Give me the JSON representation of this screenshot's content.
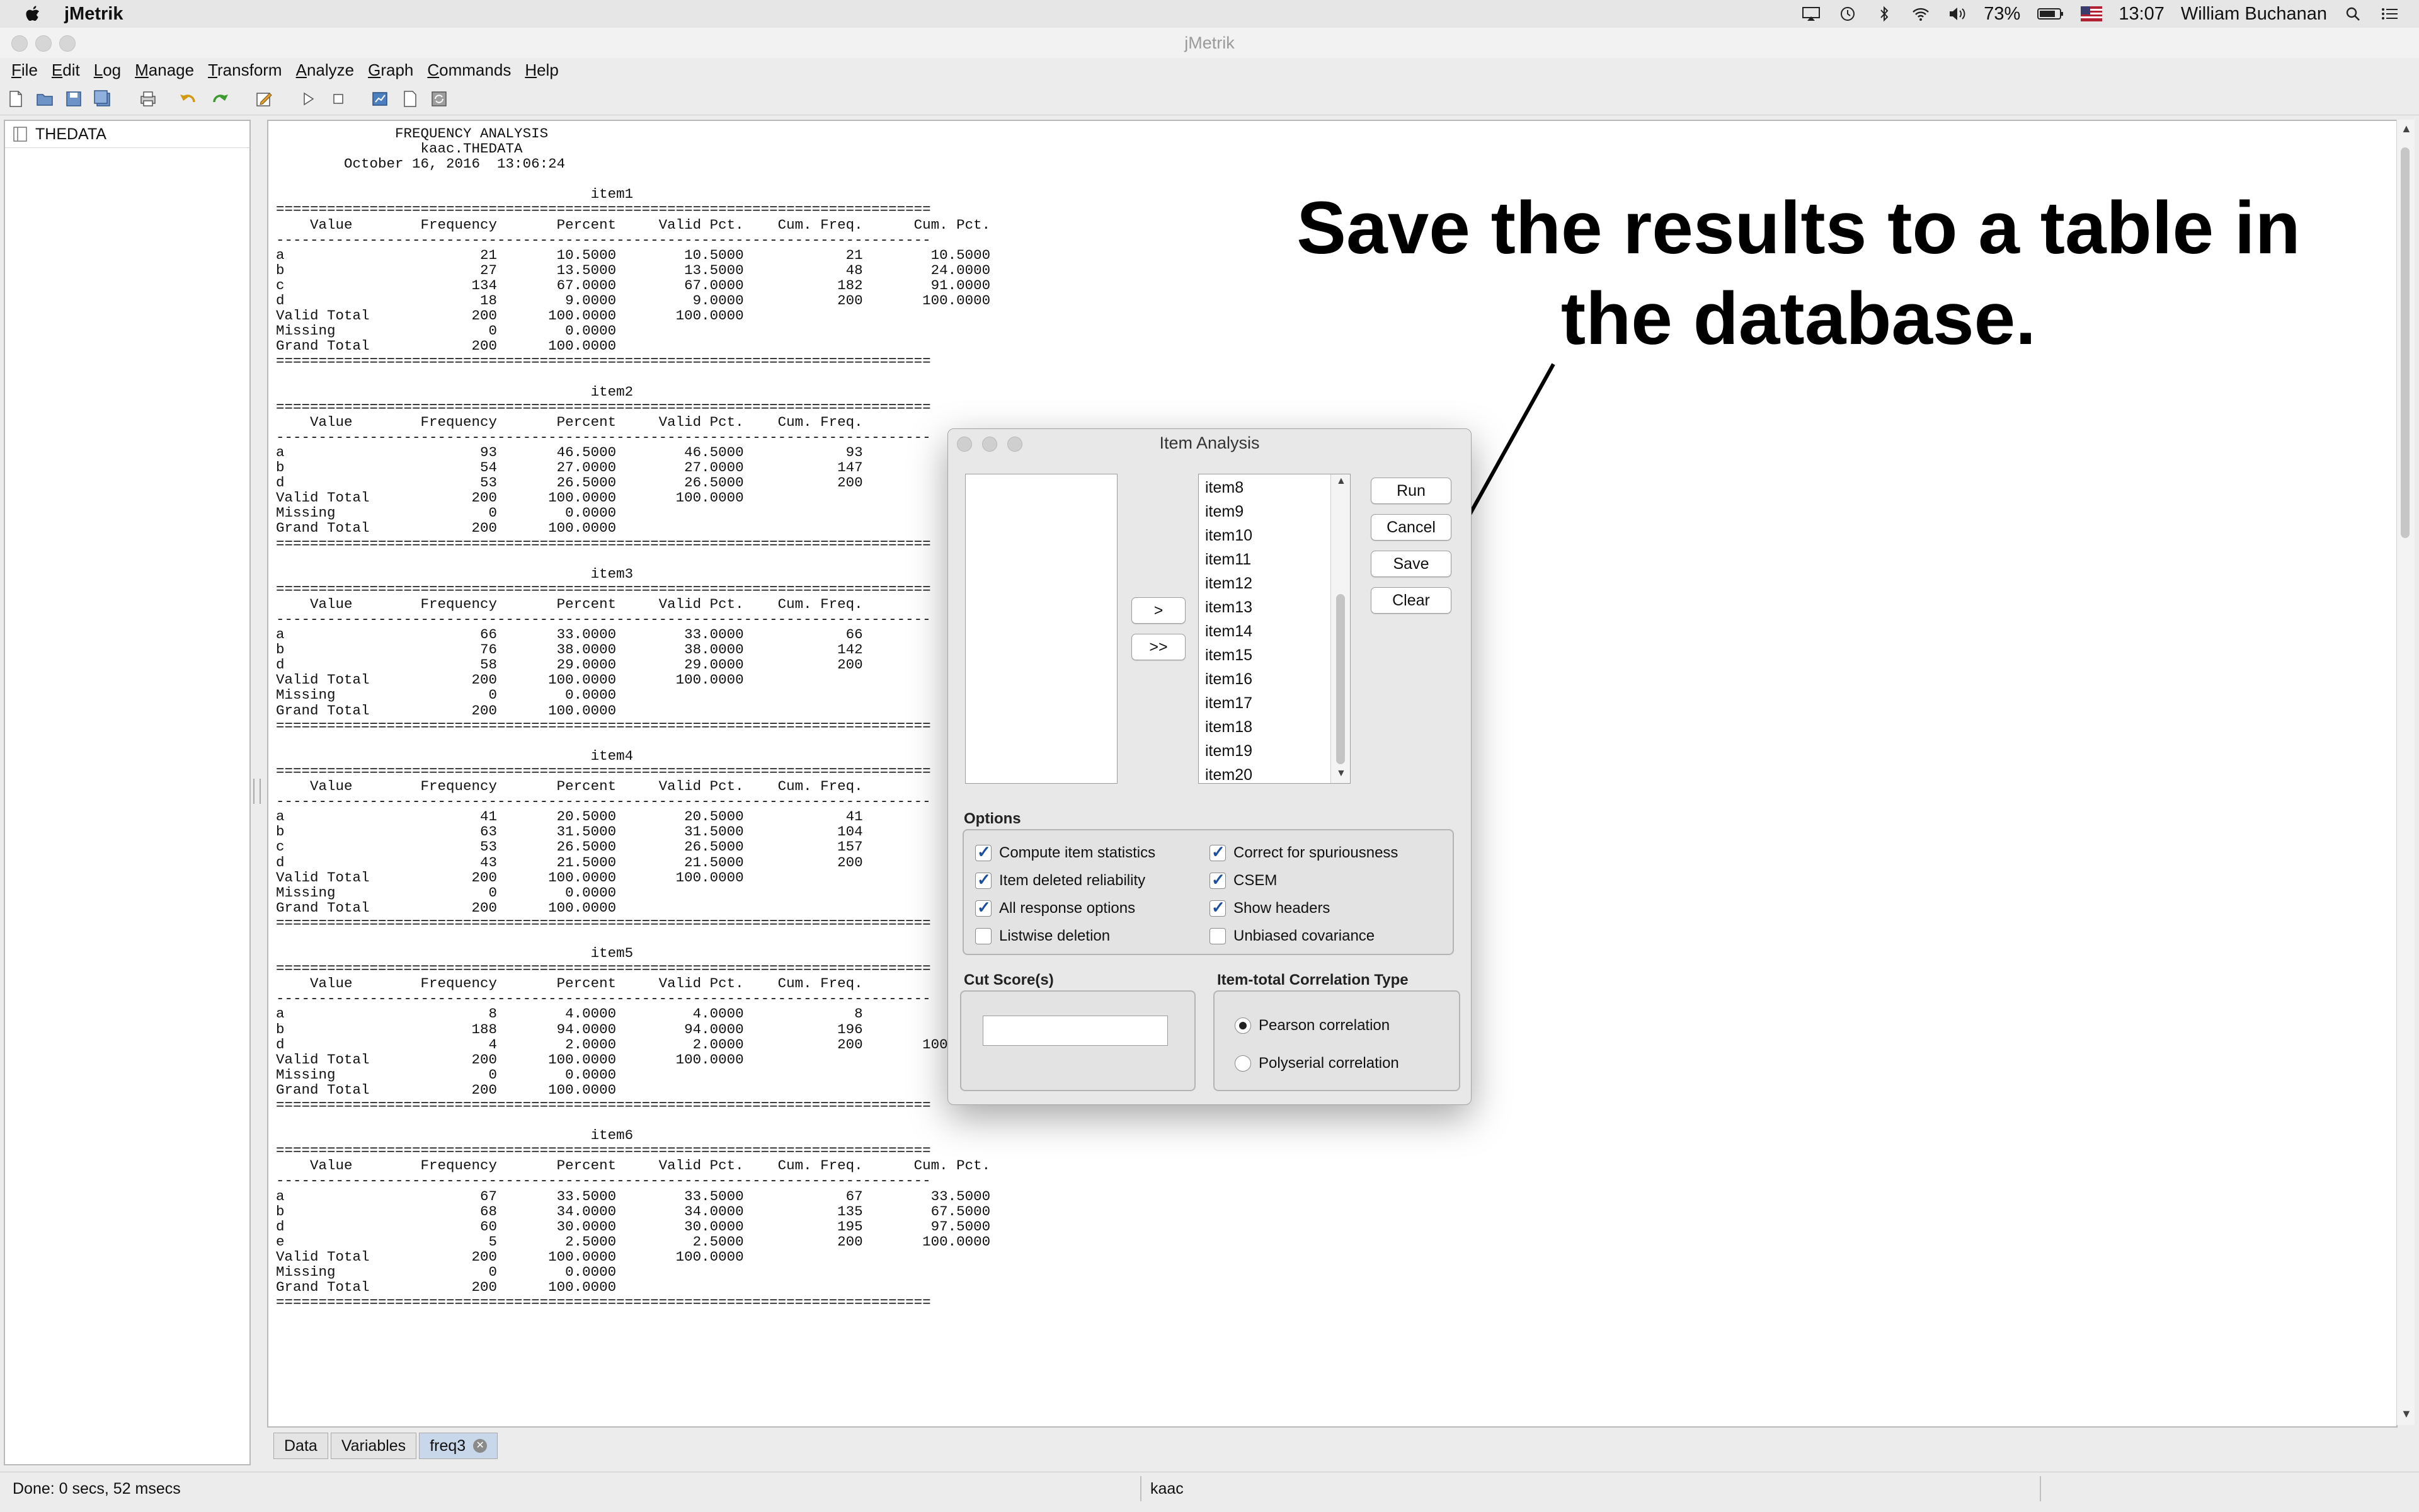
{
  "menubar": {
    "app_name": "jMetrik",
    "battery": "73%",
    "time": "13:07",
    "user": "William Buchanan"
  },
  "window": {
    "title": "jMetrik"
  },
  "app_menu": [
    "File",
    "Edit",
    "Log",
    "Manage",
    "Transform",
    "Analyze",
    "Graph",
    "Commands",
    "Help"
  ],
  "left_panel": {
    "tree_item": "THEDATA"
  },
  "report_text": "              FREQUENCY ANALYSIS\n                 kaac.THEDATA\n        October 16, 2016  13:06:24\n\n                                     item1\n=============================================================================\n    Value        Frequency       Percent     Valid Pct.    Cum. Freq.      Cum. Pct.\n-----------------------------------------------------------------------------\na                       21       10.5000        10.5000            21        10.5000\nb                       27       13.5000        13.5000            48        24.0000\nc                      134       67.0000        67.0000           182        91.0000\nd                       18        9.0000         9.0000           200       100.0000\nValid Total            200      100.0000       100.0000\nMissing                  0        0.0000\nGrand Total            200      100.0000\n=============================================================================\n\n                                     item2\n=============================================================================\n    Value        Frequency       Percent     Valid Pct.    Cum. Freq.\n-----------------------------------------------------------------------------\na                       93       46.5000        46.5000            93\nb                       54       27.0000        27.0000           147\nd                       53       26.5000        26.5000           200\nValid Total            200      100.0000       100.0000\nMissing                  0        0.0000\nGrand Total            200      100.0000\n=============================================================================\n\n                                     item3\n=============================================================================\n    Value        Frequency       Percent     Valid Pct.    Cum. Freq.\n-----------------------------------------------------------------------------\na                       66       33.0000        33.0000            66\nb                       76       38.0000        38.0000           142\nd                       58       29.0000        29.0000           200\nValid Total            200      100.0000       100.0000\nMissing                  0        0.0000\nGrand Total            200      100.0000\n=============================================================================\n\n                                     item4\n=============================================================================\n    Value        Frequency       Percent     Valid Pct.    Cum. Freq.\n-----------------------------------------------------------------------------\na                       41       20.5000        20.5000            41\nb                       63       31.5000        31.5000           104\nc                       53       26.5000        26.5000           157\nd                       43       21.5000        21.5000           200\nValid Total            200      100.0000       100.0000\nMissing                  0        0.0000\nGrand Total            200      100.0000\n=============================================================================\n\n                                     item5\n=============================================================================\n    Value        Frequency       Percent     Valid Pct.    Cum. Freq.\n-----------------------------------------------------------------------------\na                        8        4.0000         4.0000             8\nb                      188       94.0000        94.0000           196\nd                        4        2.0000         2.0000           200       100.0000\nValid Total            200      100.0000       100.0000\nMissing                  0        0.0000\nGrand Total            200      100.0000\n=============================================================================\n\n                                     item6\n=============================================================================\n    Value        Frequency       Percent     Valid Pct.    Cum. Freq.      Cum. Pct.\n-----------------------------------------------------------------------------\na                       67       33.5000        33.5000            67        33.5000\nb                       68       34.0000        34.0000           135        67.5000\nd                       60       30.0000        30.0000           195        97.5000\ne                        5        2.5000         2.5000           200       100.0000\nValid Total            200      100.0000       100.0000\nMissing                  0        0.0000\nGrand Total            200      100.0000\n=============================================================================",
  "annotation": "Save the results to a table in the database.",
  "dialog": {
    "title": "Item Analysis",
    "items": [
      "item8",
      "item9",
      "item10",
      "item11",
      "item12",
      "item13",
      "item14",
      "item15",
      "item16",
      "item17",
      "item18",
      "item19",
      "item20"
    ],
    "buttons": {
      "run": "Run",
      "cancel": "Cancel",
      "save": "Save",
      "clear": "Clear",
      "move_one": ">",
      "move_all": ">>"
    },
    "options_label": "Options",
    "options": [
      {
        "label": "Compute item statistics",
        "checked": true
      },
      {
        "label": "Correct for spuriousness",
        "checked": true
      },
      {
        "label": "Item deleted reliability",
        "checked": true
      },
      {
        "label": "CSEM",
        "checked": true
      },
      {
        "label": "All response options",
        "checked": true
      },
      {
        "label": "Show headers",
        "checked": true
      },
      {
        "label": "Listwise deletion",
        "checked": false
      },
      {
        "label": "Unbiased covariance",
        "checked": false
      }
    ],
    "cut_score_label": "Cut Score(s)",
    "cut_score_value": "",
    "correlation_label": "Item-total Correlation Type",
    "correlation_options": [
      {
        "label": "Pearson correlation",
        "selected": true
      },
      {
        "label": "Polyserial correlation",
        "selected": false
      }
    ]
  },
  "tabs": [
    {
      "label": "Data",
      "active": false
    },
    {
      "label": "Variables",
      "active": false
    },
    {
      "label": "freq3",
      "active": true
    }
  ],
  "status": {
    "left": "Done: 0 secs, 52 msecs",
    "middle": "kaac"
  }
}
